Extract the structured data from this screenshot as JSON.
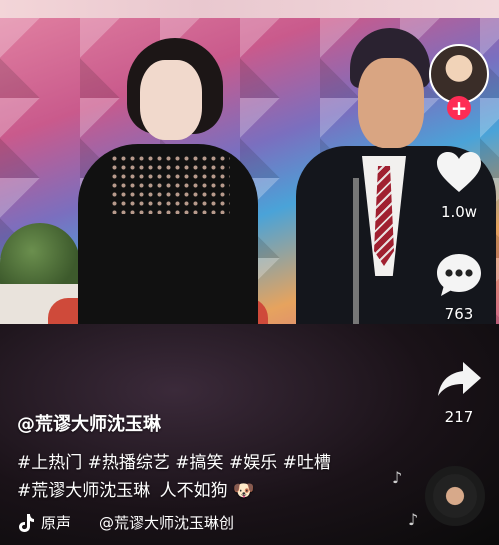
{
  "video": {
    "description_visible": false
  },
  "side_rail": {
    "follow_symbol": "+",
    "like_count": "1.0w",
    "comment_count": "763",
    "share_count": "217"
  },
  "caption": {
    "username": "@荒谬大师沈玉琳",
    "hashtags_line1": "#上热门 #热播综艺 #搞笑 #娱乐 #吐槽",
    "hashtags_line2": "#荒谬大师沈玉琳",
    "line2_suffix": "人不如狗",
    "line2_emoji": "🐶"
  },
  "music": {
    "label": "原声",
    "owner": "@荒谬大师沈玉琳创"
  },
  "colors": {
    "follow": "#fe2c55",
    "text": "#ffffff"
  }
}
